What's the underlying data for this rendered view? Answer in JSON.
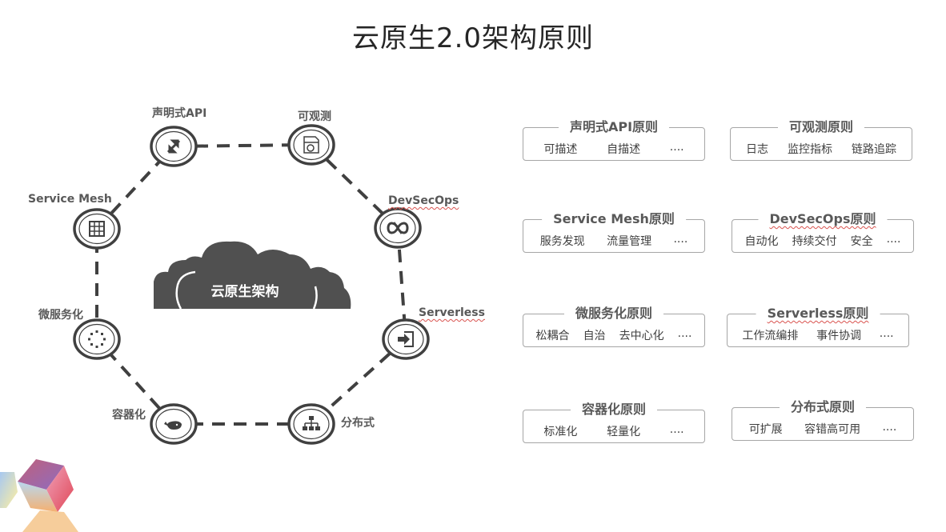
{
  "title": "云原生2.0架构原则",
  "center": {
    "label": "云原生架构",
    "icon": "cloud-icon"
  },
  "nodes": [
    {
      "label": "声明式API",
      "icon": "swap-arrows-icon"
    },
    {
      "label": "可观测",
      "icon": "document-search-icon"
    },
    {
      "label": "DevSecOps",
      "icon": "infinity-loop-icon"
    },
    {
      "label": "Serverless",
      "icon": "sign-in-icon"
    },
    {
      "label": "分布式",
      "icon": "hierarchy-icon"
    },
    {
      "label": "容器化",
      "icon": "docker-whale-icon"
    },
    {
      "label": "微服务化",
      "icon": "dotted-circle-icon"
    },
    {
      "label": "Service Mesh",
      "icon": "grid-icon"
    }
  ],
  "principles": [
    {
      "title": "声明式API原则",
      "items": [
        "可描述",
        "自描述",
        "...."
      ]
    },
    {
      "title": "可观测原则",
      "items": [
        "日志",
        "监控指标",
        "链路追踪"
      ]
    },
    {
      "title": "Service Mesh原则",
      "items": [
        "服务发现",
        "流量管理",
        "...."
      ]
    },
    {
      "title": "DevSecOps原则",
      "items": [
        "自动化",
        "持续交付",
        "安全",
        "...."
      ]
    },
    {
      "title": "微服务化原则",
      "items": [
        "松耦合",
        "自治",
        "去中心化",
        "...."
      ]
    },
    {
      "title": "Serverless原则",
      "items": [
        "工作流编排",
        "事件协调",
        "...."
      ]
    },
    {
      "title": "容器化原则",
      "items": [
        "标准化",
        "轻量化",
        "...."
      ]
    },
    {
      "title": "分布式原则",
      "items": [
        "可扩展",
        "容错高可用",
        "...."
      ]
    }
  ],
  "colors": {
    "node_stroke": "#404040",
    "cloud_fill": "#505050",
    "card_border": "#a6a6a6"
  }
}
